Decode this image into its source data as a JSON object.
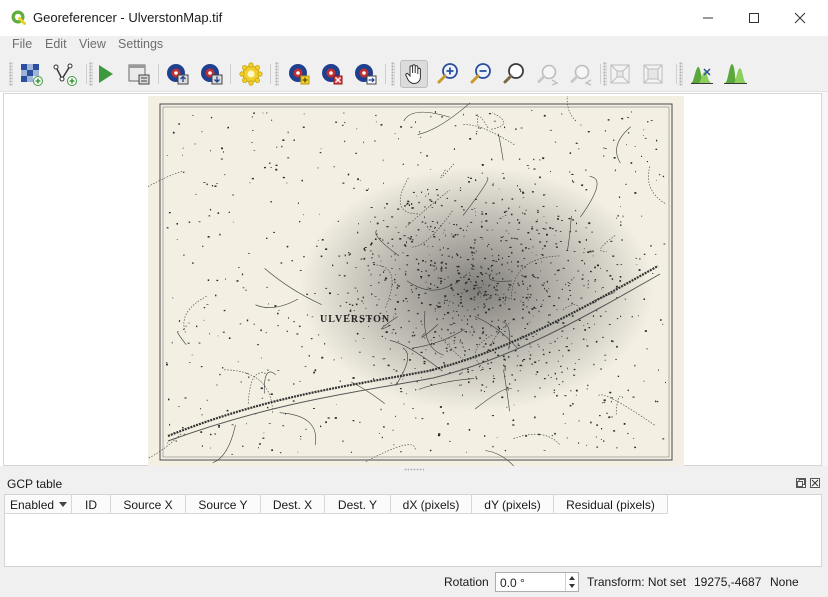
{
  "window": {
    "title": "Georeferencer - UlverstonMap.tif",
    "app_icon": "qgis-icon",
    "controls": [
      "minimize-icon",
      "maximize-icon",
      "close-icon"
    ]
  },
  "menu": {
    "items": [
      "File",
      "Edit",
      "View",
      "Settings"
    ]
  },
  "toolbar": {
    "buttons": [
      {
        "name": "open-raster",
        "icon": "open-raster-icon"
      },
      {
        "name": "open-vector",
        "icon": "add-vector-point-icon"
      },
      {
        "name": "start-georeferencing",
        "icon": "play-icon"
      },
      {
        "name": "generate-gdal-script",
        "icon": "gdal-script-icon"
      },
      {
        "name": "load-gcp-points",
        "icon": "load-gcp-icon"
      },
      {
        "name": "save-gcp-points",
        "icon": "save-gcp-icon"
      },
      {
        "name": "transformation-settings",
        "icon": "settings-gear-icon"
      },
      {
        "name": "add-point",
        "icon": "add-point-icon"
      },
      {
        "name": "delete-point",
        "icon": "delete-point-icon"
      },
      {
        "name": "move-gcp-point",
        "icon": "move-point-icon"
      },
      {
        "name": "pan",
        "icon": "pan-hand-icon",
        "active": true
      },
      {
        "name": "zoom-in",
        "icon": "zoom-in-icon"
      },
      {
        "name": "zoom-out",
        "icon": "zoom-out-icon"
      },
      {
        "name": "zoom-to-layer",
        "icon": "zoom-layer-icon"
      },
      {
        "name": "zoom-last",
        "icon": "zoom-last-icon"
      },
      {
        "name": "zoom-next",
        "icon": "zoom-next-icon"
      },
      {
        "name": "link-georeferencer",
        "icon": "link-geo-icon"
      },
      {
        "name": "link-qgis",
        "icon": "link-qgis-icon"
      },
      {
        "name": "local-histogram-stretch",
        "icon": "local-histogram-icon"
      },
      {
        "name": "full-histogram-stretch",
        "icon": "full-histogram-icon"
      }
    ]
  },
  "canvas": {
    "map_label": "ULVERSTON"
  },
  "gcp_panel": {
    "title": "GCP table",
    "columns": [
      "Enabled",
      "ID",
      "Source X",
      "Source Y",
      "Dest. X",
      "Dest. Y",
      "dX (pixels)",
      "dY (pixels)",
      "Residual (pixels)"
    ],
    "rows": []
  },
  "status": {
    "rotation_label": "Rotation",
    "rotation_value": "0.0 °",
    "transform": "Transform: Not set",
    "coordinates": "19275,-4687",
    "crs": "None"
  },
  "colors": {
    "accent_green": "#3c9a3c",
    "gcp_blue": "#1f3f8f",
    "gcp_red": "#c03030",
    "map_paper": "#f3efe3"
  }
}
